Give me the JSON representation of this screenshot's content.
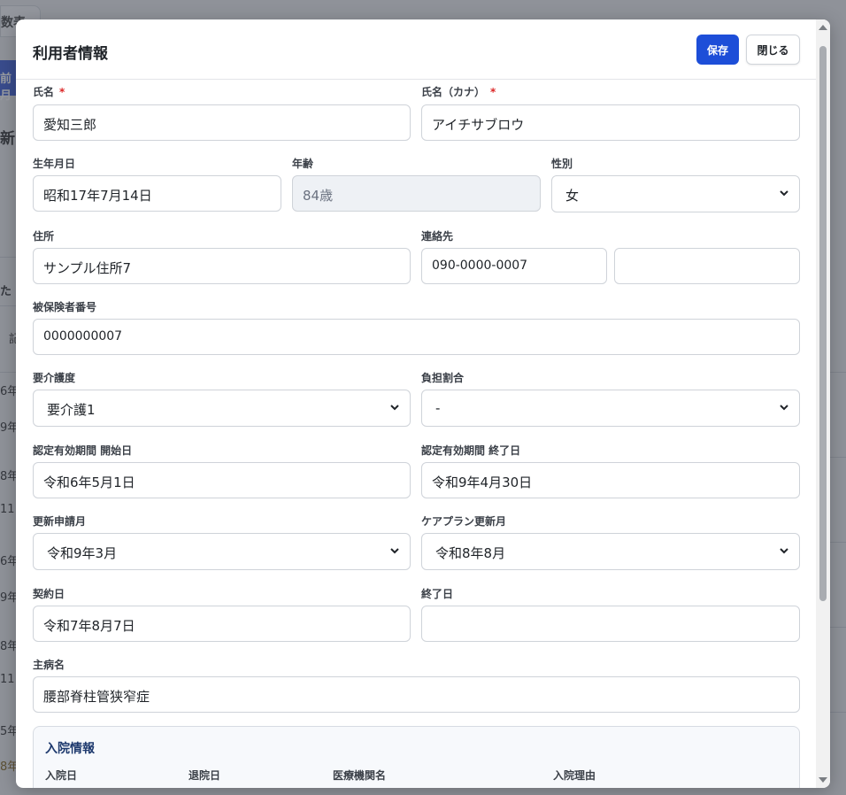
{
  "background": {
    "tab_label": "数表",
    "button_label": "前月",
    "fragments": [
      "新",
      "た",
      "記",
      "6年",
      "9年",
      "8年",
      "11",
      "6年",
      "9年",
      "8年",
      "11",
      "5年",
      "8年"
    ]
  },
  "modal": {
    "title": "利用者情報",
    "save_label": "保存",
    "close_label": "閉じる"
  },
  "form": {
    "required_mark": "*",
    "name": {
      "label": "氏名",
      "value": "愛知三郎"
    },
    "kana": {
      "label": "氏名（カナ）",
      "value": "アイチサブロウ"
    },
    "birthdate": {
      "label": "生年月日",
      "value": "昭和17年7月14日"
    },
    "age": {
      "label": "年齢",
      "value": "84歳"
    },
    "gender": {
      "label": "性別",
      "value": "女"
    },
    "address": {
      "label": "住所",
      "value": "サンプル住所7"
    },
    "contact": {
      "label": "連絡先",
      "value": "090-0000-0007",
      "value2": ""
    },
    "insured_number": {
      "label": "被保険者番号",
      "value": "0000000007"
    },
    "care_level": {
      "label": "要介護度",
      "value": "要介護1"
    },
    "burden_ratio": {
      "label": "負担割合",
      "value": "-"
    },
    "cert_start": {
      "label": "認定有効期間 開始日",
      "value": "令和6年5月1日"
    },
    "cert_end": {
      "label": "認定有効期間 終了日",
      "value": "令和9年4月30日"
    },
    "renewal_month": {
      "label": "更新申請月",
      "value": "令和9年3月"
    },
    "careplan_month": {
      "label": "ケアプラン更新月",
      "value": "令和8年8月"
    },
    "contract_date": {
      "label": "契約日",
      "value": "令和7年8月7日"
    },
    "end_date": {
      "label": "終了日",
      "value": ""
    },
    "diagnosis": {
      "label": "主病名",
      "value": "腰部脊柱管狭窄症"
    }
  },
  "hospital": {
    "title": "入院情報",
    "columns": [
      "入院日",
      "退院日",
      "医療機関名",
      "入院理由"
    ]
  },
  "colors": {
    "primary": "#1d4ed8",
    "required": "#dc2626",
    "disabled_bg": "#eef1f5"
  }
}
